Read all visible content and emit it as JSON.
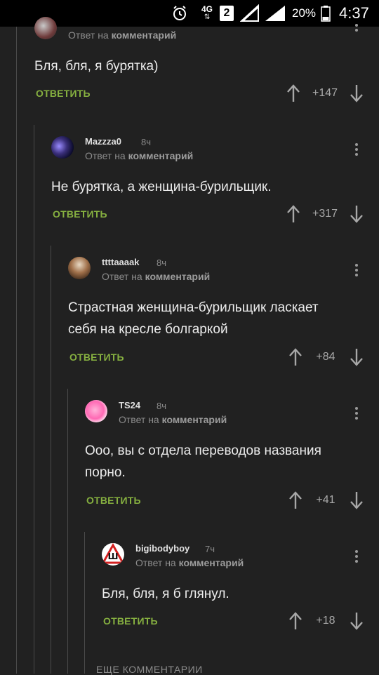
{
  "status_bar": {
    "network": "4G",
    "sim": "2",
    "battery": "20%",
    "time": "4:37",
    "icons": [
      "alarm-icon",
      "network-4g-icon",
      "sim-2-icon",
      "no-signal-icon",
      "signal-icon",
      "battery-icon"
    ]
  },
  "reply_prefix": "Ответ на",
  "reply_target": "комментарий",
  "reply_label": "ОТВЕТИТЬ",
  "comments": [
    {
      "author": "",
      "time": "",
      "text": "Бля, бля, я бурятка)",
      "score": "+147"
    },
    {
      "author": "Mazzza0",
      "time": "8ч",
      "text": "Не бурятка, а женщина-бурильщик.",
      "score": "+317"
    },
    {
      "author": "ttttaaaak",
      "time": "8ч",
      "text_lines": [
        "Страстная женщина-бурильщик ласкает",
        "себя на кресле болгаркой"
      ],
      "score": "+84"
    },
    {
      "author": "TS24",
      "time": "8ч",
      "text_lines": [
        "Ооо, вы с отдела переводов названия",
        "порно."
      ],
      "score": "+41"
    },
    {
      "author": "bigibodyboy",
      "time": "7ч",
      "text": "Бля, бля, я б глянул.",
      "score": "+18",
      "avatar_letter": "Ш"
    }
  ],
  "more_comments": "ЕЩЕ КОММЕНТАРИИ",
  "colors": {
    "background": "#212121",
    "reply_green": "#86b040",
    "thread_line": "#4a4a4a"
  }
}
